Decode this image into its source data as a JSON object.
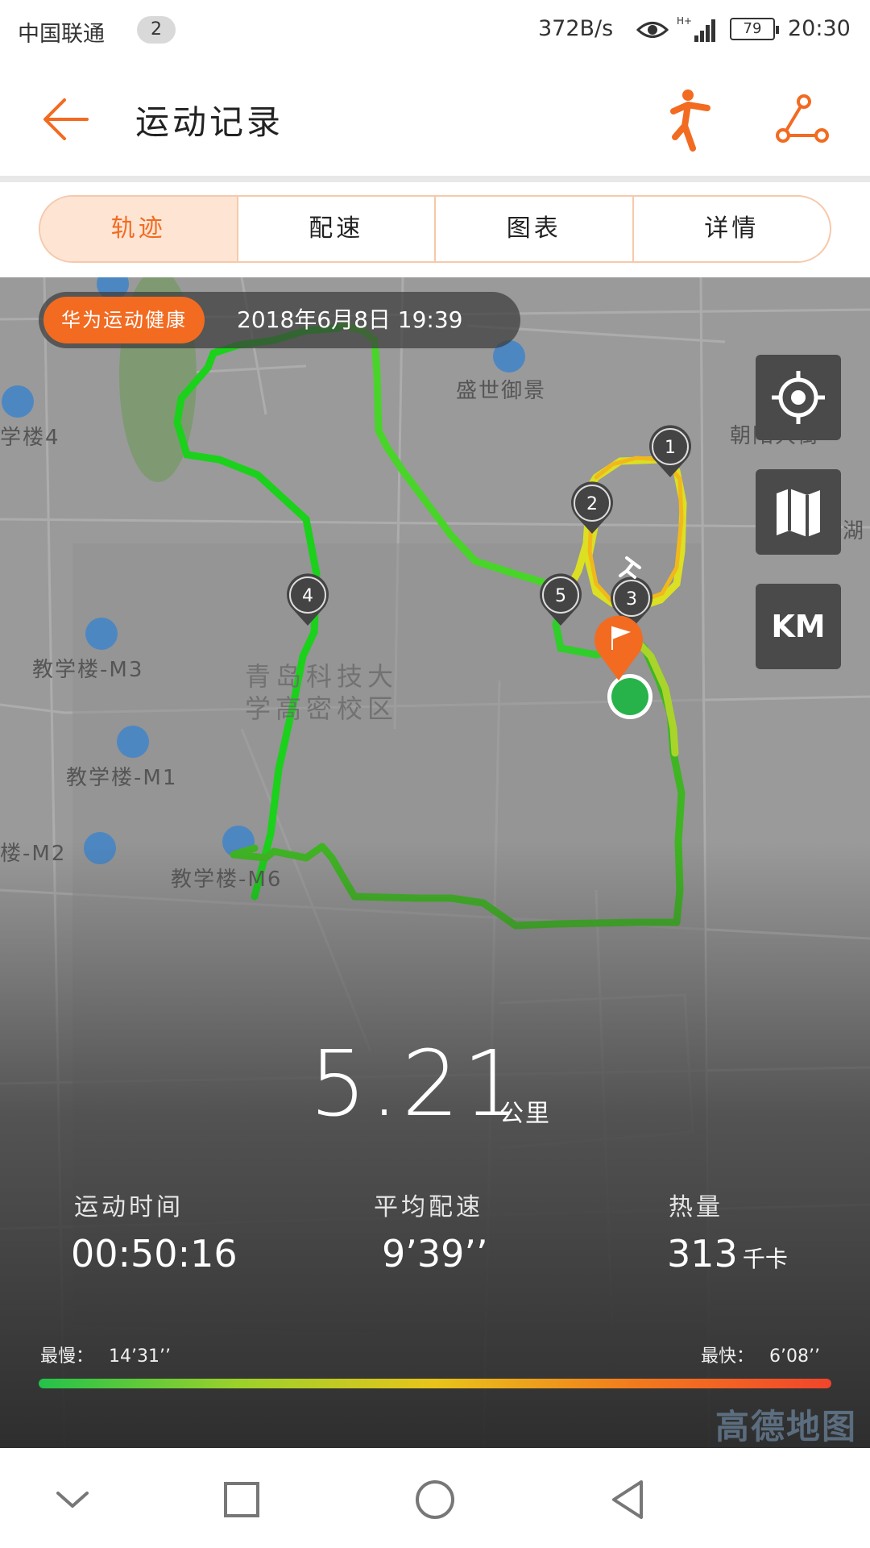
{
  "status_bar": {
    "carrier": "中国联通",
    "sim_badge": "2",
    "net_speed": "372B/s",
    "battery": "79",
    "time": "20:30",
    "icons": [
      "eye-icon",
      "signal-icon",
      "battery-icon"
    ]
  },
  "header": {
    "title": "运动记录",
    "icons": [
      "back-arrow-icon",
      "running-person-icon",
      "route-share-icon"
    ],
    "accent": "#f26b21"
  },
  "tabs": [
    {
      "label": "轨迹",
      "active": true
    },
    {
      "label": "配速",
      "active": false
    },
    {
      "label": "图表",
      "active": false
    },
    {
      "label": "详情",
      "active": false
    }
  ],
  "map": {
    "brand_tag": "华为运动健康",
    "datetime": "2018年6月8日 19:39",
    "buttons": {
      "locate": "locate-icon",
      "map": "map-icon",
      "unit": "KM"
    },
    "labels": {
      "shengshi": "盛世御景",
      "campus_line1": "青岛科技大",
      "campus_line2": "学高密校区",
      "building_4": "学楼4",
      "building_m3": "教学楼-M3",
      "building_m1": "教学楼-M1",
      "building_m2": "楼-M2",
      "building_m6": "教学楼-M6",
      "street": "朝阳大街",
      "edge": "湖"
    },
    "markers": [
      "1",
      "2",
      "3",
      "4",
      "5"
    ],
    "amap_logo": "高德地图"
  },
  "summary": {
    "distance": "5.21",
    "distance_unit": "公里",
    "time_label": "运动时间",
    "time_value": "00:50:16",
    "pace_label": "平均配速",
    "pace_value": "9’39’’",
    "calorie_label": "热量",
    "calorie_value": "313",
    "calorie_unit": "千卡",
    "slowest_label": "最慢：",
    "slowest_value": "14’31’’",
    "fastest_label": "最快：",
    "fastest_value": "6’08’’"
  },
  "nav_bar": {
    "icons": [
      "collapse-icon",
      "recents-icon",
      "home-icon",
      "back-icon"
    ]
  }
}
